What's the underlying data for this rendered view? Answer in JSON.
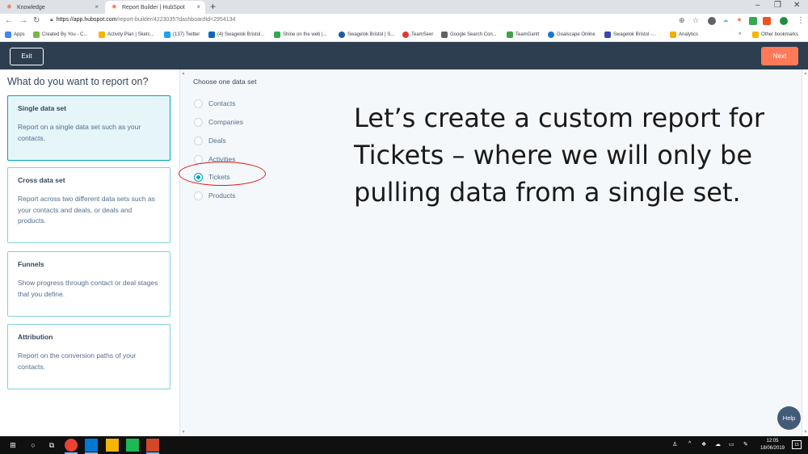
{
  "browser": {
    "tabs": [
      {
        "label": "Knowledge",
        "close": "×"
      },
      {
        "label": "Report Builder | HubSpot",
        "close": "×"
      }
    ],
    "new_tab": "+",
    "window_controls": {
      "minimize": "–",
      "restore": "❐",
      "close": "✕"
    },
    "url_host": "https://app.hubspot.com",
    "url_path": "/report-builder/4223035?dashboardId=2954134",
    "bookmarks": [
      {
        "label": "Apps",
        "color": "#4285f4"
      },
      {
        "label": "Created By You - C...",
        "color": "#7cb342"
      },
      {
        "label": "Activity Plan | Sketc...",
        "color": "#f4b400"
      },
      {
        "label": "(137) Twitter",
        "color": "#1da1f2"
      },
      {
        "label": "(4) Swagelok Bristol...",
        "color": "#0a66c2"
      },
      {
        "label": "Shine on the web |...",
        "color": "#34a853"
      },
      {
        "label": "Swagelok Bristol | S...",
        "color": "#1e5aa8"
      },
      {
        "label": "TeamSeer",
        "color": "#e53935"
      },
      {
        "label": "Google Search Con...",
        "color": "#5f6368"
      },
      {
        "label": "TeamGantt",
        "color": "#43a047"
      },
      {
        "label": "Goalscape Online",
        "color": "#1976d2"
      },
      {
        "label": "Swagelok Bristol -...",
        "color": "#3949ab"
      },
      {
        "label": "Analytics",
        "color": "#f9ab00"
      }
    ],
    "bookmarks_more": "»",
    "other_bookmarks": "Other bookmarks"
  },
  "header": {
    "exit_label": "Exit",
    "next_label": "Next"
  },
  "left": {
    "title": "What do you want to report on?",
    "cards": [
      {
        "title": "Single data set",
        "desc": "Report on a single data set such as your contacts."
      },
      {
        "title": "Cross data set",
        "desc": "Report across two different data sets such as your contacts and deals, or deals and products."
      },
      {
        "title": "Funnels",
        "desc": "Show progress through contact or deal stages that you define."
      },
      {
        "title": "Attribution",
        "desc": "Report on the conversion paths of your contacts."
      }
    ]
  },
  "main": {
    "title": "Choose one data set",
    "options": [
      {
        "label": "Contacts",
        "checked": false
      },
      {
        "label": "Companies",
        "checked": false
      },
      {
        "label": "Deals",
        "checked": false
      },
      {
        "label": "Activities",
        "checked": false
      },
      {
        "label": "Tickets",
        "checked": true
      },
      {
        "label": "Products",
        "checked": false
      }
    ],
    "overlay_text": "Let’s create a custom report for Tickets – where we will only be pulling data from a single set.",
    "help_label": "Help"
  },
  "taskbar": {
    "time": "12:05",
    "date": "18/06/2019",
    "notifications": "15"
  },
  "colors": {
    "accent": "#00a4bd",
    "brand_orange": "#ff7a59",
    "header_bg": "#2d3e50",
    "annotation": "#e0181b"
  }
}
